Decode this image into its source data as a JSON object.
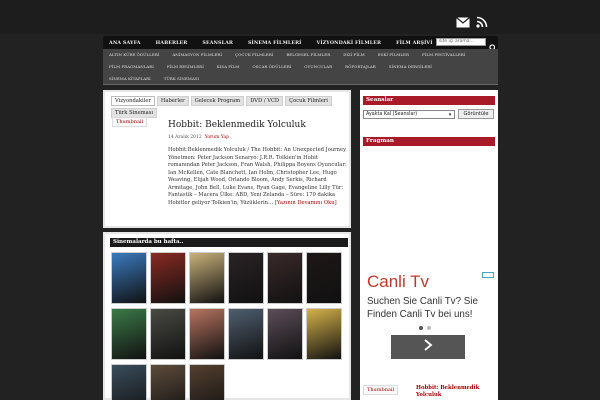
{
  "colors": {
    "accent": "#a81a28",
    "nav_bg": "#111111",
    "page_bg": "#222222"
  },
  "top_icons": [
    "mail-icon",
    "rss-icon"
  ],
  "main_nav": [
    "ANA SAYFA",
    "HABERLER",
    "SEANSLAR",
    "SİNEMA FİLMLERİ",
    "VİZYONDAKİ FİLMLER",
    "FİLM ARŞİVİ"
  ],
  "search": {
    "placeholder": "site içi arama..."
  },
  "sub_nav": [
    "ALTIN KÜRE ÖDÜLLERİ",
    "ANİMASYON FİLMLERİ",
    "ÇOCUK FİLMLERİ",
    "BELGESEL FİLMLER",
    "DİZİ FİLM",
    "ESKİ FİLMLER",
    "FİLM FESTİVALLERİ",
    "FİLM FRAGMANLARI",
    "FİLM RESİMLERİ",
    "KISA FİLM",
    "OSCAR ÖDÜLLERİ",
    "OYUNCULAR",
    "RÖPORTAJLAR",
    "SİNEMA DERGİLERİ",
    "SİNEMA KİTAPLARI",
    "TÜRK SİNEMASI"
  ],
  "tabs": [
    "Vizyondakiler",
    "Haberler",
    "Gelecek Program",
    "DVD / VCD",
    "Çocuk Filmleri",
    "Türk Sineması"
  ],
  "post": {
    "thumbnail": "Thumbnail",
    "title": "Hobbit: Beklenmedik Yolculuk",
    "date": "14 Aralık 2012",
    "comment": "Yorum Yap",
    "body": "Hobbit:Beklenmedik Yolculuk / The Hobbit: An Unexpected Journey Yönetmen: Peter Jackson Senaryo: J.R.R. Tolkien'in Hobit romanından Peter Jackson, Fran Walsh, Philippa Boyens Oyuncular: Ian McKellen, Cate Blanchett, Ian Holm, Christopher Lee, Hugo Weaving, Elijah Wood, Orlando Bloom, Andy Serkis, Richard Armitage, John Bell, Luke Evans, Ryan Gage, Evangeline Lilly Tür: Fantastik – Macera Ülke: ABD, Yeni Zelanda – Süre: 170 dakika Hobitler geliyor Tolkien'in, Yüzüklerin…",
    "read_more": "[Yazının Devamını Oku]"
  },
  "sinema": {
    "heading": "Sinemalarda bu hafta..",
    "posters": [
      "#3b7bc0",
      "#8a2a22",
      "#c9b27a",
      "#2a2325",
      "#3a2a2a",
      "#1e1717",
      "#3b7a48",
      "#4a4a44",
      "#b7745f",
      "#4f5f6f",
      "#5c4d5a",
      "#d6b24a",
      "#3a4d5c",
      "#5e4c3a",
      "#54402f"
    ]
  },
  "sidebar": {
    "seanslar_title": "Seanslar",
    "select_value": "Ayakta Kal (Seanslar)",
    "go_button": "Görüntüle",
    "fragman_title": "Fragman",
    "ad": {
      "title": "Canli Tv",
      "text": "Suchen Sie Canli Tv? Sie Finden Canli Tv bei uns!"
    },
    "bottom_thumb": "Thumbnail",
    "bottom_link": "Hobbit: Beklenmedik Yolculuk"
  }
}
